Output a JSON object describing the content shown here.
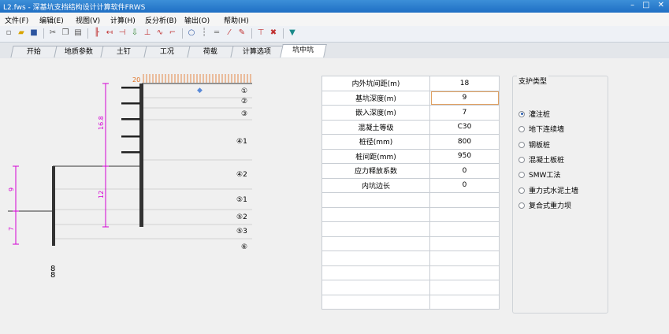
{
  "window": {
    "title": "L2.fws - 深基坑支挡结构设计计算软件FRWS"
  },
  "menu": [
    "文件(F)",
    "编辑(E)",
    "视图(V)",
    "计算(H)",
    "反分析(B)",
    "输出(O)",
    "帮助(H)"
  ],
  "toolbar_icons": [
    "new-icon",
    "open-icon",
    "save-icon",
    "cut-icon",
    "copy-icon",
    "paste-icon",
    "pile-icon",
    "anchor-icon",
    "strut-icon",
    "load-icon",
    "soil-icon",
    "water-icon",
    "step-icon",
    "circle-icon",
    "support-icon",
    "beam-icon",
    "slope-icon",
    "draw-icon",
    "pick-icon",
    "delete-icon",
    "calc-icon"
  ],
  "tabs": [
    "开始",
    "地质参数",
    "土钉",
    "工况",
    "荷载",
    "计算选项",
    "坑中坑"
  ],
  "active_tab": 6,
  "param_table": [
    {
      "label": "内外坑间距(m)",
      "value": "18"
    },
    {
      "label": "基坑深度(m)",
      "value": "9"
    },
    {
      "label": "嵌入深度(m)",
      "value": "7"
    },
    {
      "label": "混凝土等级",
      "value": "C30"
    },
    {
      "label": "桩径(mm)",
      "value": "800"
    },
    {
      "label": "桩间距(mm)",
      "value": "950"
    },
    {
      "label": "应力释放系数",
      "value": "0"
    },
    {
      "label": "内坑边长",
      "value": "0"
    }
  ],
  "empty_rows": 8,
  "support_type": {
    "legend": "支护类型",
    "options": [
      "灌注桩",
      "地下连续墙",
      "钢板桩",
      "混凝土板桩",
      "SMW工法",
      "重力式水泥土墙",
      "复合式重力坝"
    ],
    "selected": 0
  },
  "drawing": {
    "load_value": "20",
    "dim_outer_depth": "16.8",
    "dim_outer_embed": "12",
    "dim_inner_depth": "9",
    "dim_inner_embed": "7",
    "soil_layers": [
      "①",
      "②",
      "③",
      "④1",
      "④2",
      "⑤1",
      "⑤2",
      "⑤3",
      "⑥"
    ],
    "pile_symbol": "8"
  },
  "colors": {
    "dimension": "#d400d4",
    "load": "#e07020",
    "titlebar": "#2a7fd4"
  }
}
